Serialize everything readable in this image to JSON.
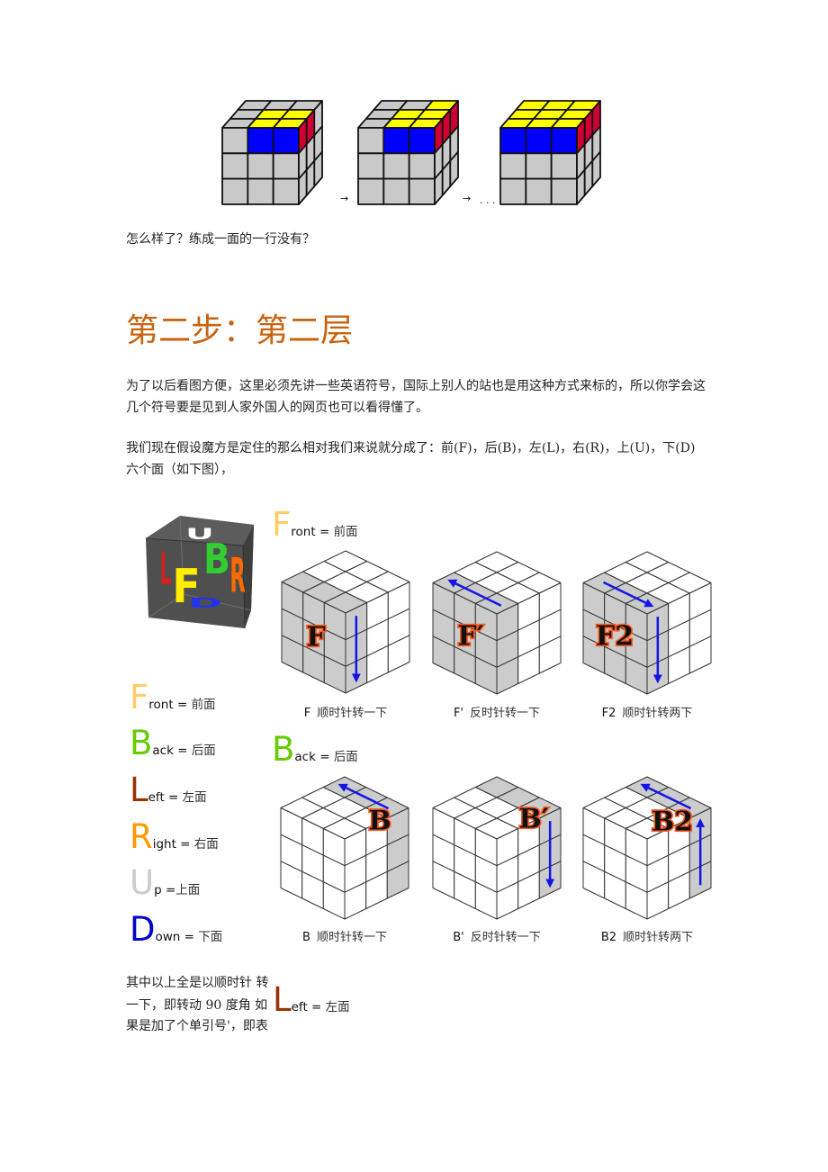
{
  "intro": {
    "question": "怎么样了？练成一面的一行没有？"
  },
  "top_sequence": {
    "palette": {
      "g": "#c9c9c9",
      "y": "#ffff00",
      "b": "#0000ff",
      "r": "#d00035"
    },
    "cubes": [
      {
        "top": [
          "ggg",
          "gyy",
          "gyy"
        ],
        "front": [
          "gbb",
          "ggg",
          "ggg"
        ],
        "right": [
          "rrg",
          "ggg",
          "ggg"
        ]
      },
      {
        "top": [
          "ggy",
          "gyy",
          "gyy"
        ],
        "front": [
          "gbb",
          "ggg",
          "ggg"
        ],
        "right": [
          "rrr",
          "ggg",
          "ggg"
        ]
      },
      {
        "top": [
          "yyy",
          "yyy",
          "yyy"
        ],
        "front": [
          "bbb",
          "ggg",
          "ggg"
        ],
        "right": [
          "rrr",
          "ggg",
          "ggg"
        ]
      }
    ],
    "arrow_symbol": "→",
    "ellipsis": ". . ."
  },
  "section": {
    "heading": "第二步：第二层",
    "paragraph1": [
      "为了以后看图方便，这里必须先讲一些英语符号，国际上别人的站也是用这种方式来标的，所以你学会这",
      "几个符号要是见到人家外国人的网页也可以看得懂了。"
    ],
    "paragraph2": [
      "我们现在假设魔方是定住的那么相对我们来说就分成了：前(F)，后(B)，左(L)，右(R)，上(U)，下(D)",
      "六个面（如下图），"
    ]
  },
  "face_cube": {
    "body_color": "#4f4f4f",
    "letters": [
      {
        "face": "up",
        "char": "U",
        "color": "#ffffff"
      },
      {
        "face": "back",
        "char": "B",
        "color": "#33cc33"
      },
      {
        "face": "right",
        "char": "R",
        "color": "#ff6a00"
      },
      {
        "face": "left",
        "char": "L",
        "color": "#cc2222"
      },
      {
        "face": "front",
        "char": "F",
        "color": "#ffee00"
      },
      {
        "face": "down",
        "char": "D",
        "color": "#2233ee"
      }
    ]
  },
  "legend": [
    {
      "letter": "F",
      "rest": "ront = ",
      "meaning": "前面",
      "color": "#ffcc66"
    },
    {
      "letter": "B",
      "rest": "ack = ",
      "meaning": "后面",
      "color": "#66cc00"
    },
    {
      "letter": "L",
      "rest": "eft = ",
      "meaning": "左面",
      "color": "#993300"
    },
    {
      "letter": "R",
      "rest": "ight = ",
      "meaning": "右面",
      "color": "#ff9900"
    },
    {
      "letter": "U",
      "rest": "p =",
      "meaning": "上面",
      "color": "#cccccc"
    },
    {
      "letter": "D",
      "rest": "own = ",
      "meaning": "下面",
      "color": "#0000cc"
    }
  ],
  "front_moves": {
    "header": {
      "letter": "F",
      "rest": "ront = ",
      "meaning": "前面",
      "color": "#ffcc66"
    },
    "moves": [
      {
        "label": "F",
        "code": "F",
        "description": "顺时针转一下",
        "layer": "front",
        "arrows": [
          "right-front-down"
        ]
      },
      {
        "label": "F′",
        "code": "F'",
        "description": "反时针转一下",
        "layer": "front",
        "arrows": [
          "top-front-leftward"
        ]
      },
      {
        "label": "F2",
        "code": "F2",
        "description": "顺时针转两下",
        "layer": "front",
        "arrows": [
          "top-front-rightward",
          "right-front-down"
        ]
      }
    ]
  },
  "back_moves": {
    "header": {
      "letter": "B",
      "rest": "ack = ",
      "meaning": "后面",
      "color": "#66cc00"
    },
    "moves": [
      {
        "label": "B",
        "code": "B",
        "description": "顺时针转一下",
        "layer": "back",
        "arrows": [
          "top-back-toward-top"
        ]
      },
      {
        "label": "B′",
        "code": "B'",
        "description": "反时针转一下",
        "layer": "back",
        "arrows": [
          "right-back-down"
        ]
      },
      {
        "label": "B2",
        "code": "B2",
        "description": "顺时针转两下",
        "layer": "back",
        "arrows": [
          "top-back-toward-top",
          "right-back-up"
        ]
      }
    ]
  },
  "note": {
    "lines": [
      "其中以上全是以顺时针 转",
      "一下，即转动 90 度角 如",
      "果是加了个单引号'，即表"
    ]
  },
  "left_header": {
    "letter": "L",
    "rest": "eft = ",
    "meaning": "左面",
    "color": "#993300"
  },
  "style": {
    "arrow_color": "#1414e6",
    "sticker_gray": "#cccccc",
    "sticker_white": "#ffffff"
  }
}
